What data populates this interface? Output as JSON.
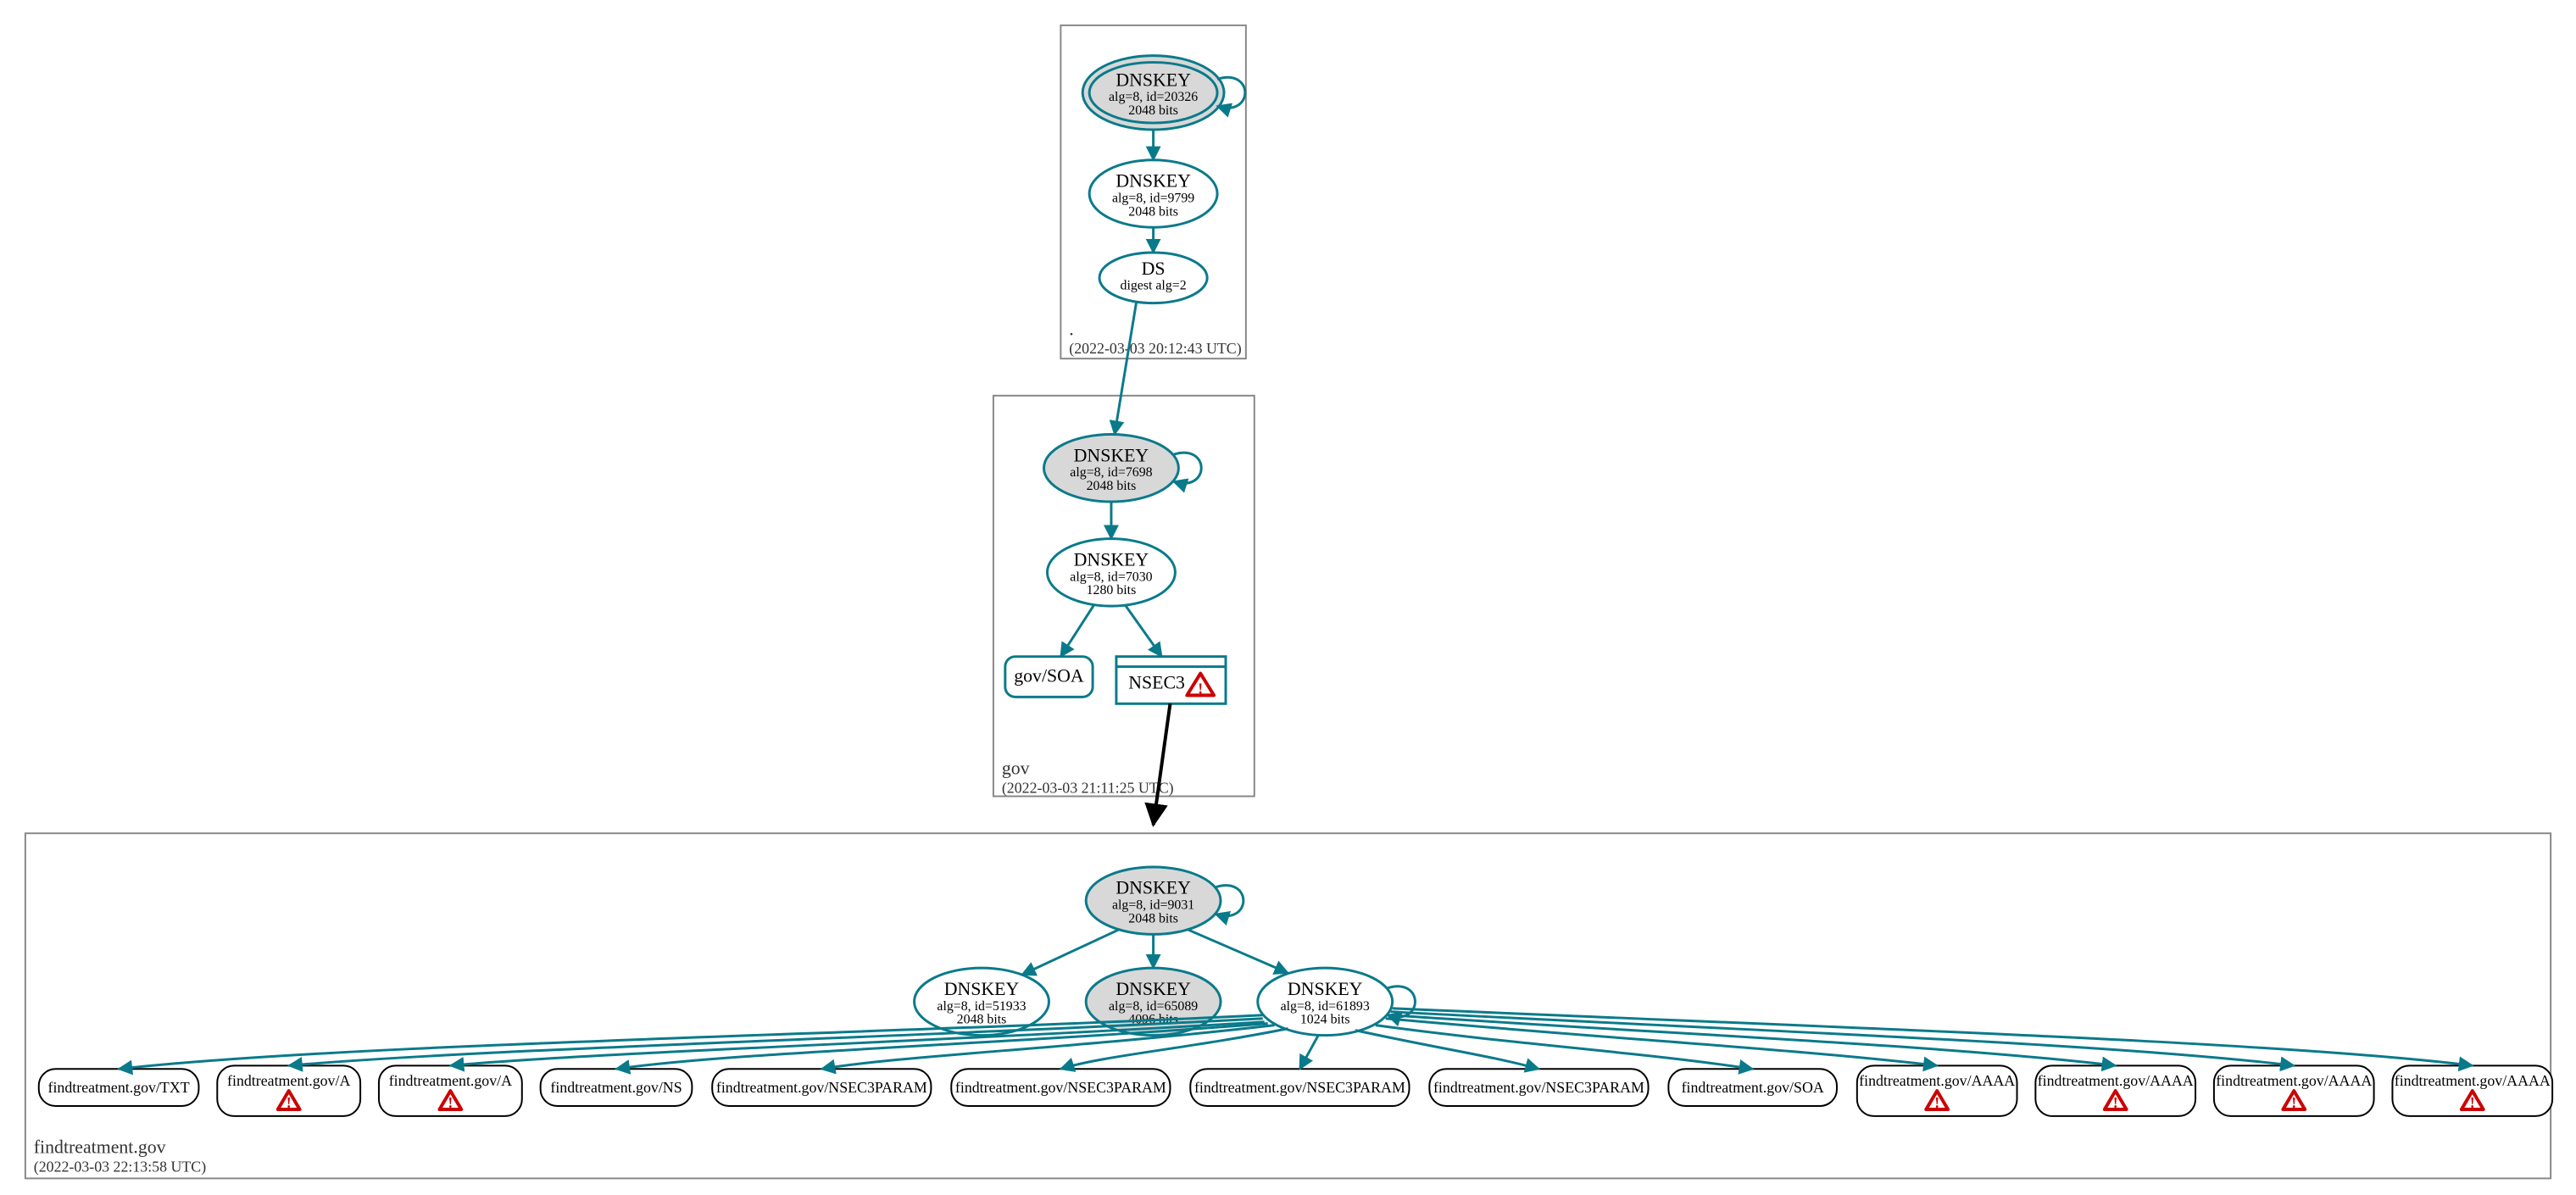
{
  "zones": {
    "root": {
      "label": ".",
      "timestamp": "(2022-03-03 20:12:43 UTC)"
    },
    "gov": {
      "label": "gov",
      "timestamp": "(2022-03-03 21:11:25 UTC)"
    },
    "findtreatment": {
      "label": "findtreatment.gov",
      "timestamp": "(2022-03-03 22:13:58 UTC)"
    }
  },
  "nodes": {
    "root_ksk": {
      "title": "DNSKEY",
      "line2": "alg=8, id=20326",
      "line3": "2048 bits"
    },
    "root_zsk": {
      "title": "DNSKEY",
      "line2": "alg=8, id=9799",
      "line3": "2048 bits"
    },
    "root_ds": {
      "title": "DS",
      "line2": "digest alg=2"
    },
    "gov_ksk": {
      "title": "DNSKEY",
      "line2": "alg=8, id=7698",
      "line3": "2048 bits"
    },
    "gov_zsk": {
      "title": "DNSKEY",
      "line2": "alg=8, id=7030",
      "line3": "1280 bits"
    },
    "gov_soa": {
      "title": "gov/SOA"
    },
    "gov_nsec3": {
      "title": "NSEC3"
    },
    "ft_ksk": {
      "title": "DNSKEY",
      "line2": "alg=8, id=9031",
      "line3": "2048 bits"
    },
    "ft_zsk_a": {
      "title": "DNSKEY",
      "line2": "alg=8, id=51933",
      "line3": "2048 bits"
    },
    "ft_zsk_b": {
      "title": "DNSKEY",
      "line2": "alg=8, id=65089",
      "line3": "4096 bits"
    },
    "ft_zsk_c": {
      "title": "DNSKEY",
      "line2": "alg=8, id=61893",
      "line3": "1024 bits"
    },
    "leaf_txt": {
      "title": "findtreatment.gov/TXT"
    },
    "leaf_a1": {
      "title": "findtreatment.gov/A"
    },
    "leaf_a2": {
      "title": "findtreatment.gov/A"
    },
    "leaf_ns": {
      "title": "findtreatment.gov/NS"
    },
    "leaf_n3p1": {
      "title": "findtreatment.gov/NSEC3PARAM"
    },
    "leaf_n3p2": {
      "title": "findtreatment.gov/NSEC3PARAM"
    },
    "leaf_n3p3": {
      "title": "findtreatment.gov/NSEC3PARAM"
    },
    "leaf_n3p4": {
      "title": "findtreatment.gov/NSEC3PARAM"
    },
    "leaf_soa": {
      "title": "findtreatment.gov/SOA"
    },
    "leaf_aaaa1": {
      "title": "findtreatment.gov/AAAA"
    },
    "leaf_aaaa2": {
      "title": "findtreatment.gov/AAAA"
    },
    "leaf_aaaa3": {
      "title": "findtreatment.gov/AAAA"
    },
    "leaf_aaaa4": {
      "title": "findtreatment.gov/AAAA"
    }
  }
}
